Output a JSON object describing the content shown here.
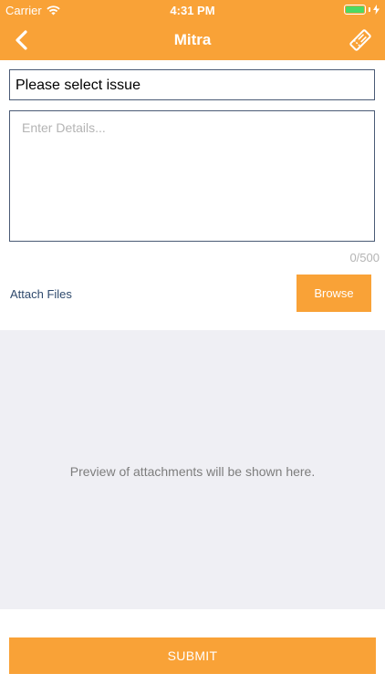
{
  "status_bar": {
    "carrier": "Carrier",
    "time": "4:31 PM"
  },
  "nav": {
    "title": "Mitra",
    "back_icon": "chevron-left-icon",
    "right_icon": "ticket-icon"
  },
  "form": {
    "issue_select_value": "Please select issue",
    "details_placeholder": "Enter Details...",
    "details_value": "",
    "char_counter": "0/500",
    "attach_label": "Attach Files",
    "browse_label": "Browse"
  },
  "preview": {
    "text": "Preview of attachments will be shown here."
  },
  "submit_label": "SUBMIT",
  "colors": {
    "accent": "#f9a237",
    "border": "#4a5a75",
    "preview_bg": "#efeff4",
    "battery": "#4cd964"
  }
}
